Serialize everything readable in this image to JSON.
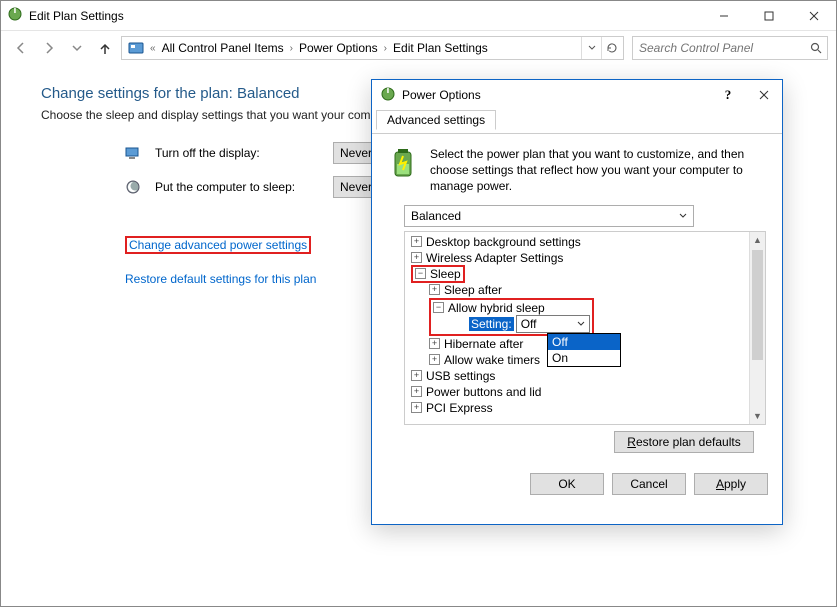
{
  "window": {
    "title": "Edit Plan Settings",
    "search_placeholder": "Search Control Panel",
    "breadcrumbs": [
      "All Control Panel Items",
      "Power Options",
      "Edit Plan Settings"
    ]
  },
  "page": {
    "heading": "Change settings for the plan: Balanced",
    "subheading": "Choose the sleep and display settings that you want your computer to use.",
    "turn_off_display_label": "Turn off the display:",
    "turn_off_display_value": "Never",
    "put_to_sleep_label": "Put the computer to sleep:",
    "put_to_sleep_value": "Never",
    "adv_link": "Change advanced power settings",
    "restore_link": "Restore default settings for this plan"
  },
  "dialog": {
    "title": "Power Options",
    "tab": "Advanced settings",
    "desc": "Select the power plan that you want to customize, and then choose settings that reflect how you want your computer to manage power.",
    "plan": "Balanced",
    "tree": {
      "desktop_bg": "Desktop background settings",
      "wireless": "Wireless Adapter Settings",
      "sleep": "Sleep",
      "sleep_after": "Sleep after",
      "hybrid": "Allow hybrid sleep",
      "setting_label": "Setting:",
      "setting_value": "Off",
      "dd_off": "Off",
      "dd_on": "On",
      "hibernate": "Hibernate after",
      "wake_timers": "Allow wake timers",
      "usb": "USB settings",
      "pbl": "Power buttons and lid",
      "pcie": "PCI Express"
    },
    "restore_btn": "Restore plan defaults",
    "ok": "OK",
    "cancel": "Cancel",
    "apply": "Apply"
  }
}
